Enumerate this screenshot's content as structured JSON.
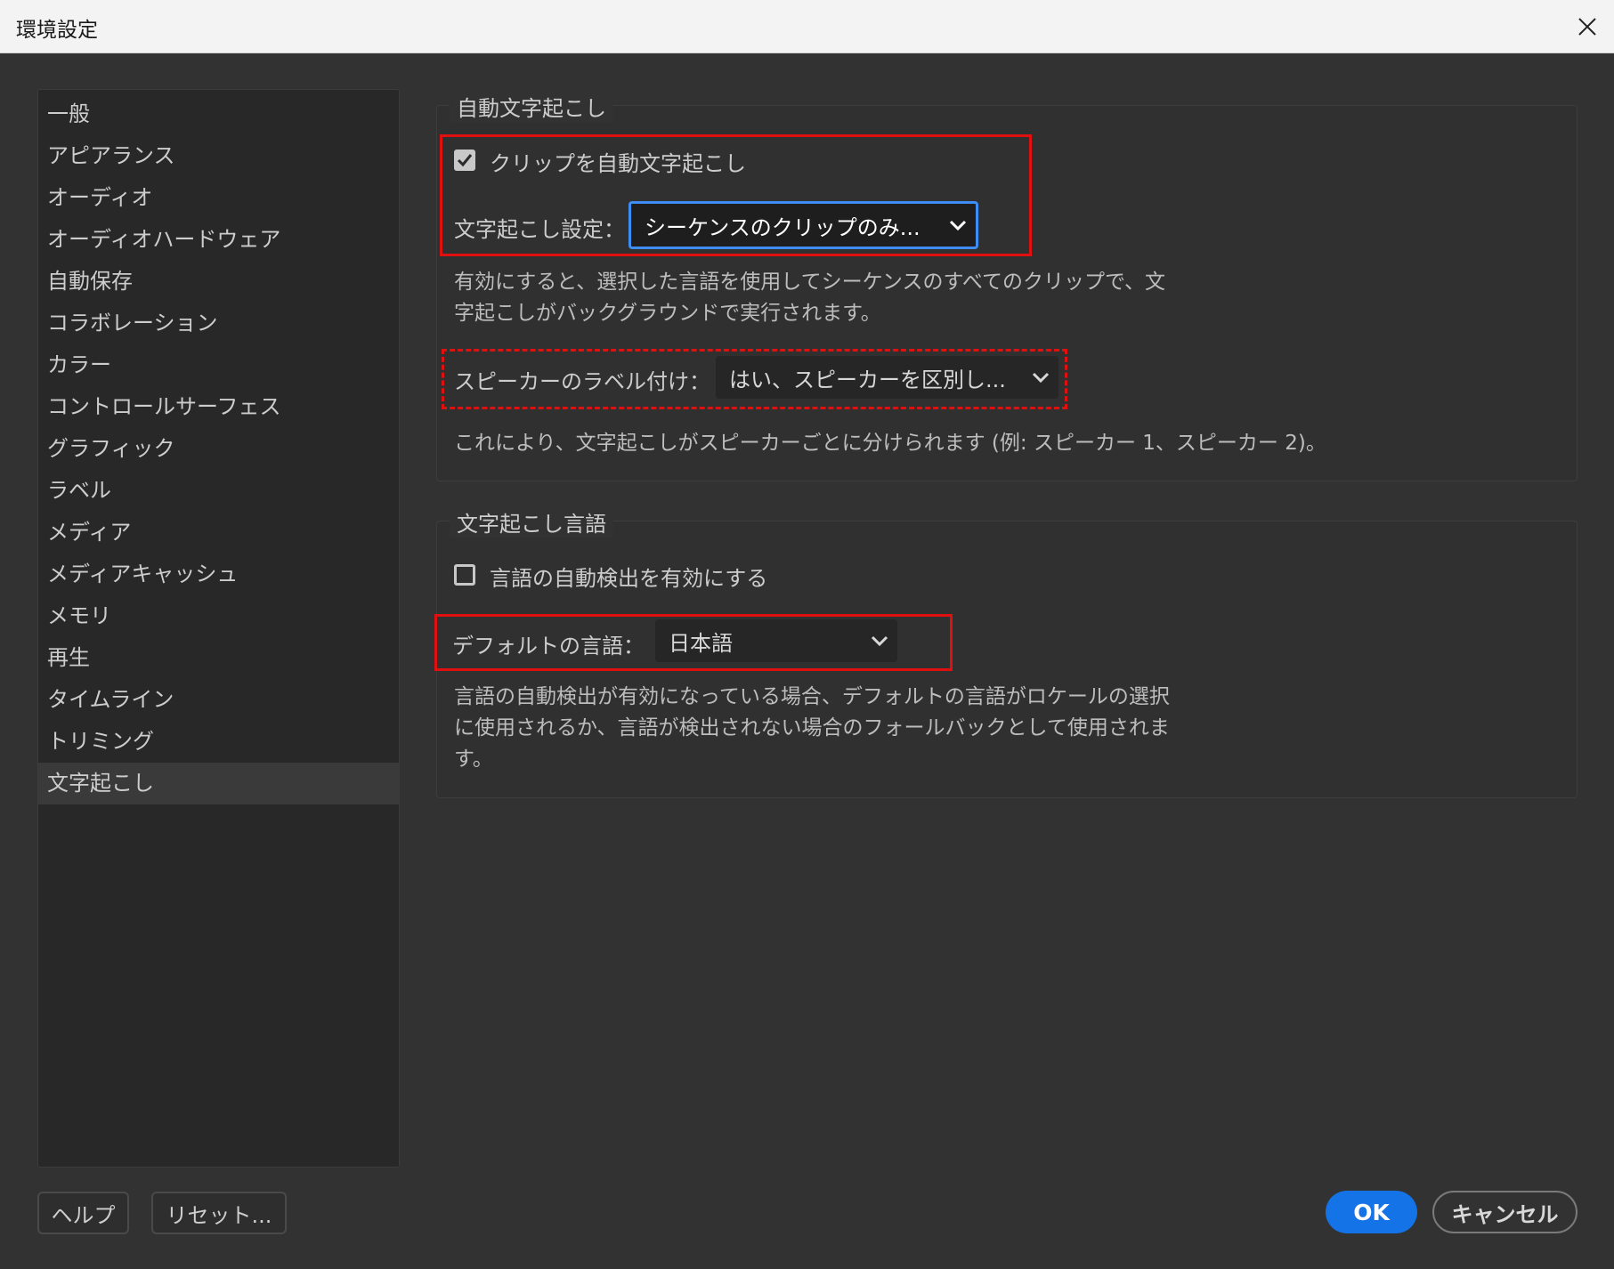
{
  "window": {
    "title": "環境設定"
  },
  "sidebar": {
    "items": [
      {
        "label": "一般"
      },
      {
        "label": "アピアランス"
      },
      {
        "label": "オーディオ"
      },
      {
        "label": "オーディオハードウェア"
      },
      {
        "label": "自動保存"
      },
      {
        "label": "コラボレーション"
      },
      {
        "label": "カラー"
      },
      {
        "label": "コントロールサーフェス"
      },
      {
        "label": "グラフィック"
      },
      {
        "label": "ラベル"
      },
      {
        "label": "メディア"
      },
      {
        "label": "メディアキャッシュ"
      },
      {
        "label": "メモリ"
      },
      {
        "label": "再生"
      },
      {
        "label": "タイムライン"
      },
      {
        "label": "トリミング"
      },
      {
        "label": "文字起こし"
      }
    ],
    "selected_index": 16
  },
  "auto_transcription": {
    "group_title": "自動文字起こし",
    "checkbox_label": "クリップを自動文字起こし",
    "checkbox_checked": true,
    "setting_label": "文字起こし設定：",
    "setting_value": "シーケンスのクリップのみ...",
    "description_line1": "有効にすると、選択した言語を使用してシーケンスのすべてのクリップで、文",
    "description_line2": "字起こしがバックグラウンドで実行されます。",
    "speaker_label": "スピーカーのラベル付け：",
    "speaker_value": "はい、スピーカーを区別し...",
    "speaker_description": "これにより、文字起こしがスピーカーごとに分けられます (例: スピーカー 1、スピーカー 2)。"
  },
  "transcription_language": {
    "group_title": "文字起こし言語",
    "auto_detect_label": "言語の自動検出を有効にする",
    "auto_detect_checked": false,
    "default_label": "デフォルトの言語：",
    "default_value": "日本語",
    "description_line1": "言語の自動検出が有効になっている場合、デフォルトの言語がロケールの選択",
    "description_line2": "に使用されるか、言語が検出されない場合のフォールバックとして使用されま",
    "description_line3": "す。"
  },
  "buttons": {
    "help": "ヘルプ",
    "reset": "リセット...",
    "ok": "OK",
    "cancel": "キャンセル"
  },
  "colors": {
    "background": "#323232",
    "sidebar": "#282828",
    "accent": "#1473e6",
    "highlight": "#e01010"
  }
}
